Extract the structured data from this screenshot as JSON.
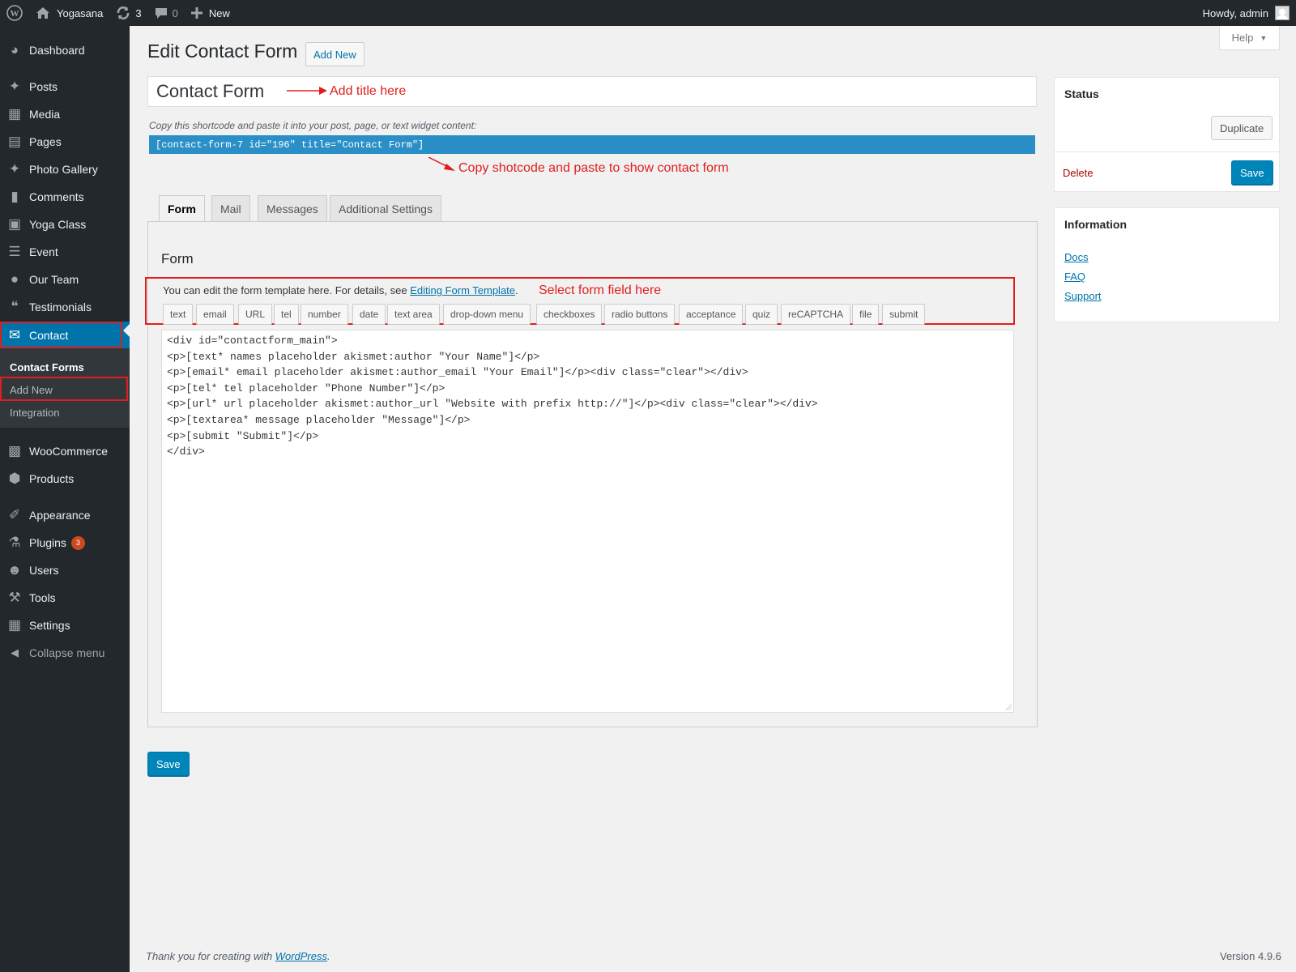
{
  "adminbar": {
    "site_name": "Yogasana",
    "updates_count": "3",
    "comments_count": "0",
    "new_label": "New",
    "howdy": "Howdy, admin"
  },
  "sidebar": {
    "items": [
      {
        "label": "Dashboard",
        "icon": "dashboard-icon"
      },
      {
        "label": "Posts",
        "icon": "pin-icon"
      },
      {
        "label": "Media",
        "icon": "media-icon"
      },
      {
        "label": "Pages",
        "icon": "pages-icon"
      },
      {
        "label": "Photo Gallery",
        "icon": "pin-icon"
      },
      {
        "label": "Comments",
        "icon": "comment-icon"
      },
      {
        "label": "Yoga Class",
        "icon": "image-icon"
      },
      {
        "label": "Event",
        "icon": "list-icon"
      },
      {
        "label": "Our Team",
        "icon": "group-icon"
      },
      {
        "label": "Testimonials",
        "icon": "quote-icon"
      },
      {
        "label": "Contact",
        "icon": "mail-icon"
      },
      {
        "label": "WooCommerce",
        "icon": "woo-icon"
      },
      {
        "label": "Products",
        "icon": "box-icon"
      },
      {
        "label": "Appearance",
        "icon": "brush-icon"
      },
      {
        "label": "Plugins",
        "icon": "plug-icon",
        "badge": "3"
      },
      {
        "label": "Users",
        "icon": "user-icon"
      },
      {
        "label": "Tools",
        "icon": "wrench-icon"
      },
      {
        "label": "Settings",
        "icon": "settings-icon"
      },
      {
        "label": "Collapse menu",
        "icon": "collapse-icon"
      }
    ],
    "submenu": [
      "Contact Forms",
      "Add New",
      "Integration"
    ]
  },
  "page": {
    "title": "Edit Contact Form",
    "add_new": "Add New",
    "form_title": "Contact Form",
    "shortcode_hint": "Copy this shortcode and paste it into your post, page, or text widget content:",
    "shortcode": "[contact-form-7 id=\"196\" title=\"Contact Form\"]",
    "annotations": {
      "add_title": "Add title here",
      "copy_shortcode": "Copy shotcode and paste to show contact form",
      "select_field": "Select form field here"
    },
    "tabs": [
      "Form",
      "Mail",
      "Messages",
      "Additional Settings"
    ],
    "panel_title": "Form",
    "template_hint_prefix": "You can edit the form template here. For details, see ",
    "template_hint_link": "Editing Form Template",
    "template_hint_suffix": ".",
    "tag_buttons": [
      "text",
      "email",
      "URL",
      "tel",
      "number",
      "date",
      "text area",
      "drop-down menu",
      "checkboxes",
      "radio buttons",
      "acceptance",
      "quiz",
      "reCAPTCHA",
      "file",
      "submit"
    ],
    "code_lines": [
      "<div id=\"contactform_main\">",
      "<p>[text* names placeholder akismet:author \"Your Name\"]</p>",
      "<p>[email* email placeholder akismet:author_email \"Your Email\"]</p><div class=\"clear\"></div>",
      "<p>[tel* tel placeholder \"Phone Number\"]</p>",
      "<p>[url* url placeholder akismet:author_url \"Website with prefix http://\"]</p><div class=\"clear\"></div>",
      "<p>[textarea* message placeholder \"Message\"]</p>",
      "<p>[submit \"Submit\"]</p>",
      "</div>"
    ],
    "save": "Save"
  },
  "status_box": {
    "title": "Status",
    "duplicate": "Duplicate",
    "delete": "Delete",
    "save": "Save"
  },
  "info_box": {
    "title": "Information",
    "links": [
      "Docs",
      "FAQ",
      "Support"
    ]
  },
  "help": "Help",
  "footer": {
    "thanks_prefix": "Thank you for creating with ",
    "thanks_link": "WordPress",
    "thanks_suffix": ".",
    "version": "Version 4.9.6"
  },
  "colors": {
    "accent": "#0073aa",
    "annotation": "#e01e1e",
    "sidebar_bg": "#23282d",
    "badge": "#ca4a1f"
  }
}
